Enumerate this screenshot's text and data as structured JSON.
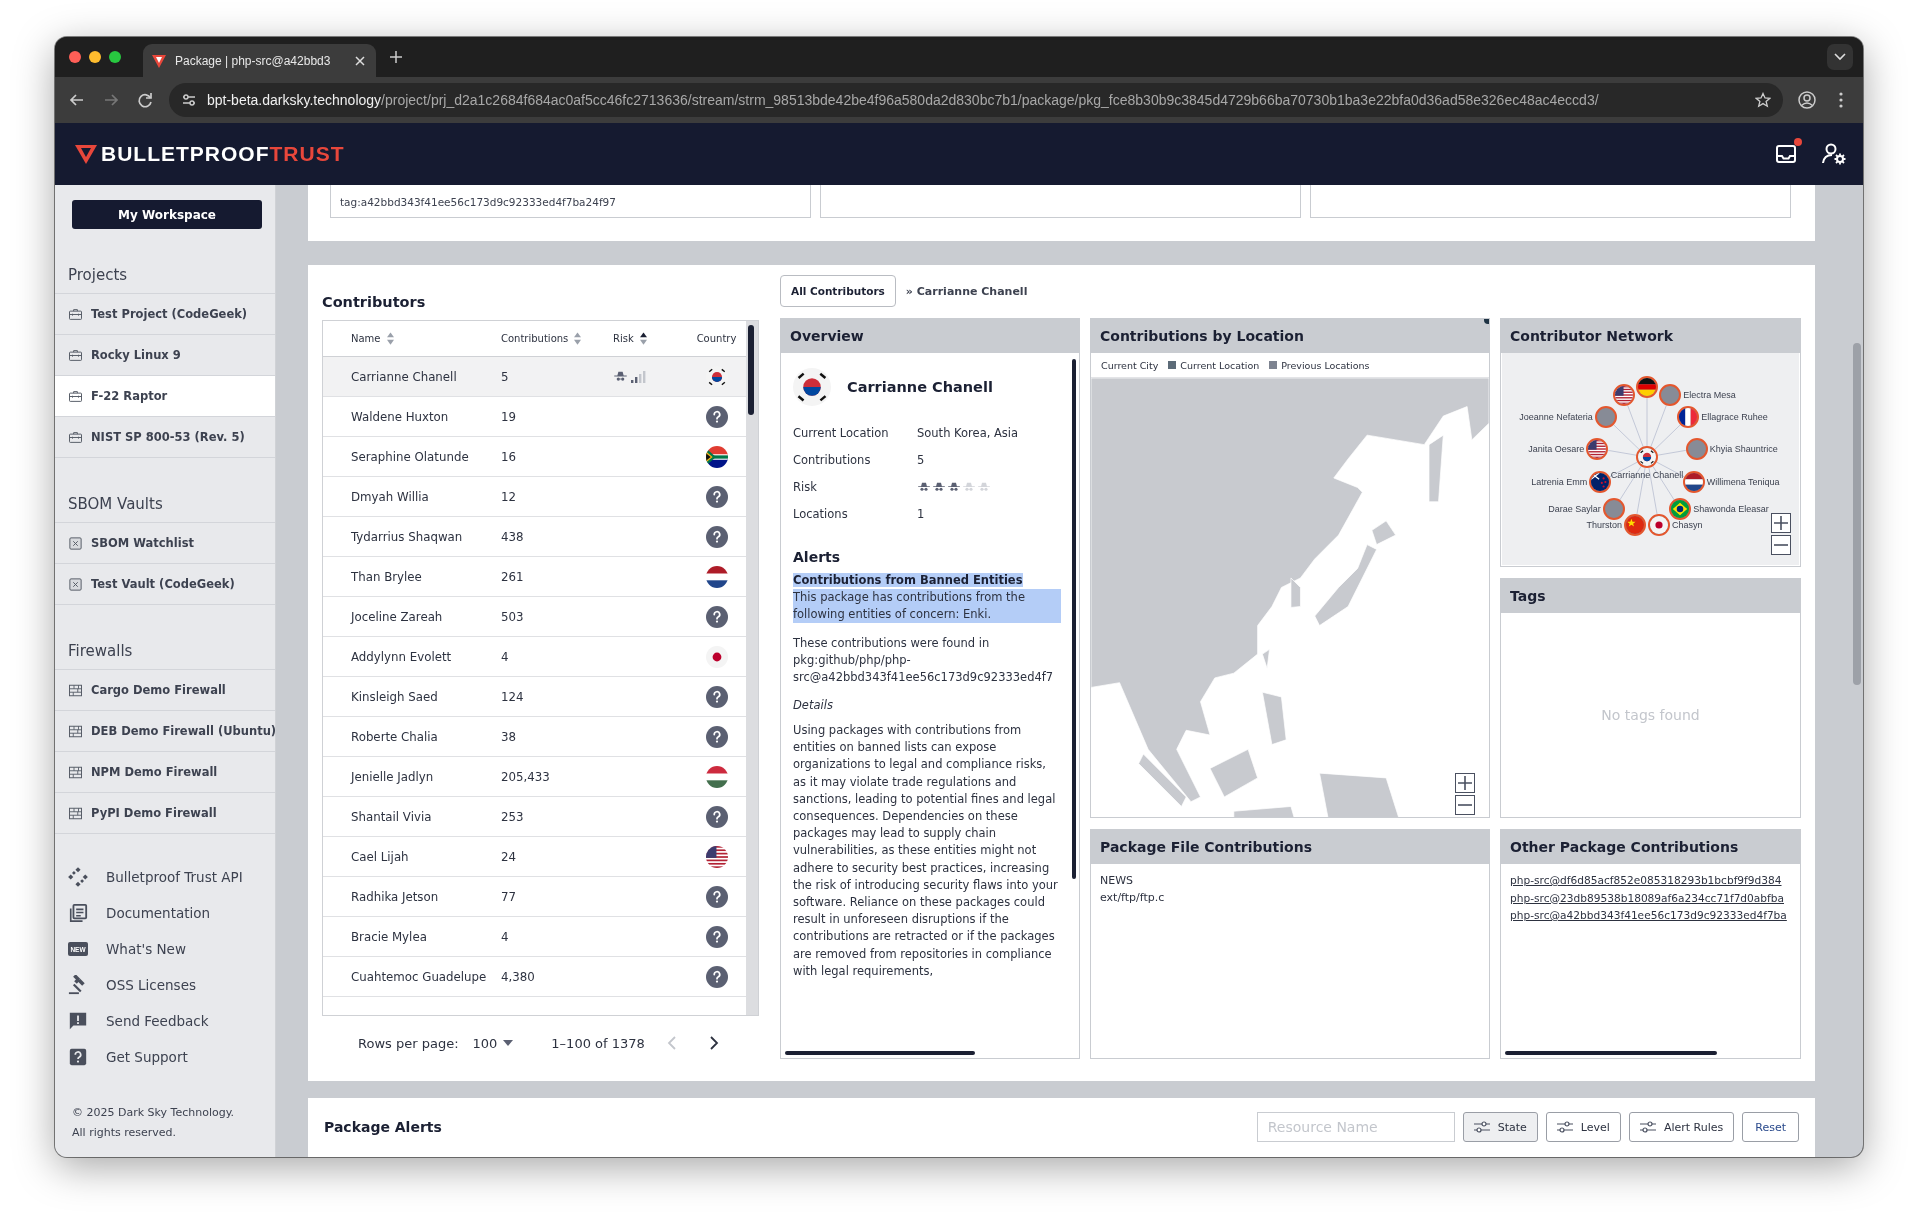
{
  "browser": {
    "tab_title": "Package | php-src@a42bbd3",
    "url_host": "bpt-beta.darksky.technology",
    "url_path": "/project/prj_d2a1c2684f684ac0af5cc46fc2713636/stream/strm_98513bde42be4f96a580da2d830bc7b1/package/pkg_fce8b30b9c3845d4729b66ba70730b1ba3e22bfa0d36ad58e326ec48ac4eccd3/"
  },
  "header": {
    "logo_primary": "BULLETPROOF",
    "logo_accent": "TRUST",
    "inbox_unread": true
  },
  "sidebar": {
    "workspace_button": "My Workspace",
    "sections": [
      {
        "title": "Projects",
        "items": [
          {
            "label": "Test Project (CodeGeek)",
            "kind": "project",
            "selected": false
          },
          {
            "label": "Rocky Linux 9",
            "kind": "project",
            "selected": false
          },
          {
            "label": "F-22 Raptor",
            "kind": "project",
            "selected": true
          },
          {
            "label": "NIST SP 800-53 (Rev. 5)",
            "kind": "project",
            "selected": false
          }
        ]
      },
      {
        "title": "SBOM Vaults",
        "items": [
          {
            "label": "SBOM Watchlist",
            "kind": "vault",
            "selected": false
          },
          {
            "label": "Test Vault (CodeGeek)",
            "kind": "vault",
            "selected": false
          }
        ]
      },
      {
        "title": "Firewalls",
        "items": [
          {
            "label": "Cargo Demo Firewall",
            "kind": "firewall",
            "selected": false
          },
          {
            "label": "DEB Demo Firewall (Ubuntu)",
            "kind": "firewall",
            "selected": false
          },
          {
            "label": "NPM Demo Firewall",
            "kind": "firewall",
            "selected": false
          },
          {
            "label": "PyPI Demo Firewall",
            "kind": "firewall",
            "selected": false
          }
        ]
      }
    ],
    "links": [
      {
        "label": "Bulletproof Trust API",
        "kind": "api"
      },
      {
        "label": "Documentation",
        "kind": "docs"
      },
      {
        "label": "What's New",
        "kind": "new",
        "badge": "NEW"
      },
      {
        "label": "OSS Licenses",
        "kind": "license"
      },
      {
        "label": "Send Feedback",
        "kind": "feedback"
      },
      {
        "label": "Get Support",
        "kind": "support"
      }
    ],
    "footer": [
      "© 2025 Dark Sky Technology.",
      "All rights reserved."
    ]
  },
  "top_cards": [
    {
      "kind": "tag",
      "text": "tag:a42bbd343f41ee56c173d9c92333ed4f7ba24f97"
    },
    {
      "kind": "empty"
    },
    {
      "kind": "empty"
    }
  ],
  "contributors": {
    "title": "Contributors",
    "columns": [
      {
        "label": "Name",
        "kind": "sortable"
      },
      {
        "label": "Contributions",
        "kind": "sortable"
      },
      {
        "label": "Risk",
        "kind": "ascending"
      },
      {
        "label": "Country",
        "kind": "plain"
      }
    ],
    "rows": [
      {
        "name": "Carrianne Chanell",
        "contributions": "5",
        "kind": "kr",
        "selected": true,
        "level": 0.5
      },
      {
        "name": "Waldene Huxton",
        "contributions": "19",
        "kind": "unknown",
        "selected": false
      },
      {
        "name": "Seraphine Olatunde",
        "contributions": "16",
        "kind": "za",
        "selected": false
      },
      {
        "name": "Dmyah Willia",
        "contributions": "12",
        "kind": "unknown",
        "selected": false
      },
      {
        "name": "Tydarrius Shaqwan",
        "contributions": "438",
        "kind": "unknown",
        "selected": false
      },
      {
        "name": "Than Brylee",
        "contributions": "261",
        "kind": "nl",
        "selected": false
      },
      {
        "name": "Joceline Zareah",
        "contributions": "503",
        "kind": "unknown",
        "selected": false
      },
      {
        "name": "Addylynn Evolett",
        "contributions": "4",
        "kind": "jp",
        "selected": false
      },
      {
        "name": "Kinsleigh Saed",
        "contributions": "124",
        "kind": "unknown",
        "selected": false
      },
      {
        "name": "Roberte Chalia",
        "contributions": "38",
        "kind": "unknown",
        "selected": false
      },
      {
        "name": "Jenielle Jadlyn",
        "contributions": "205,433",
        "kind": "hu",
        "selected": false
      },
      {
        "name": "Shantail Vivia",
        "contributions": "253",
        "kind": "unknown",
        "selected": false
      },
      {
        "name": "Cael Lijah",
        "contributions": "24",
        "kind": "us",
        "selected": false
      },
      {
        "name": "Radhika Jetson",
        "contributions": "77",
        "kind": "unknown",
        "selected": false
      },
      {
        "name": "Bracie Mylea",
        "contributions": "4",
        "kind": "unknown",
        "selected": false
      },
      {
        "name": "Cuahtemoc Guadelupe",
        "contributions": "4,380",
        "kind": "unknown",
        "selected": false
      }
    ],
    "pagination": {
      "rows_label": "Rows per page:",
      "rows_value": "100",
      "range": "1–100 of 1378",
      "prev": {
        "disabled": true
      },
      "next": {
        "disabled": false
      }
    }
  },
  "breadcrumb": {
    "button": "All Contributors",
    "current": "» Carrianne Chanell"
  },
  "overview": {
    "title": "Overview",
    "name": "Carrianne Chanell",
    "kind": "kr",
    "fields": [
      {
        "label": "Current Location",
        "kind": "text",
        "value": "South Korea, Asia"
      },
      {
        "label": "Contributions",
        "kind": "text",
        "value": "5"
      },
      {
        "label": "Risk",
        "kind": "stars",
        "stars": 3
      },
      {
        "label": "Locations",
        "kind": "text",
        "value": "1"
      }
    ],
    "alerts_title": "Alerts",
    "alerts": [
      {
        "title": "Contributions from Banned Entities",
        "message": "This package has contributions from the following entities of concern: Enki.",
        "highlighted": true,
        "found_in": "These contributions were found in pkg:github/php/php-src@a42bbd343f41ee56c173d9c92333ed4f7",
        "details_label": "Details",
        "details": "Using packages with contributions from entities on banned lists can expose organizations to legal and compliance risks, as it may violate trade regulations and sanctions, leading to potential fines and legal consequences. Dependencies on these packages may lead to supply chain vulnerabilities, as these entities might not adhere to security best practices, increasing the risk of introducing security flaws into your software. Reliance on these packages could result in unforeseen disruptions if the contributions are retracted or if the packages are removed from repositories in compliance with legal requirements,"
      }
    ]
  },
  "location": {
    "title": "Contributions by Location",
    "legend": [
      {
        "label": "Current City",
        "kind": "dot",
        "color": "#1e3344"
      },
      {
        "label": "Current Location",
        "kind": "square",
        "color": "#5c6b78"
      },
      {
        "label": "Previous Locations",
        "kind": "square",
        "color": "#7d8390"
      }
    ]
  },
  "network": {
    "title": "Contributor Network",
    "center": {
      "label": "Carrianne Chanell",
      "kind": "kr"
    },
    "nodes": [
      {
        "kind": "de"
      },
      {
        "kind": "us"
      },
      {
        "label": "Electra Mesa",
        "kind": "unknown"
      },
      {
        "label": "Joeanne Nefateria",
        "kind": "unknown"
      },
      {
        "label": "Ellagrace Ruhee",
        "kind": "fr"
      },
      {
        "label": "Janita Oesare",
        "kind": "us"
      },
      {
        "label": "Khyia Shauntrice",
        "kind": "unknown"
      },
      {
        "label": "Latrenia Emm",
        "kind": "nz"
      },
      {
        "label": "Willimena Teniqua",
        "kind": "nl"
      },
      {
        "label": "Darae Saylar",
        "kind": "unknown"
      },
      {
        "label": "Shawonda Eleasar",
        "kind": "br"
      },
      {
        "label": "Thurston",
        "kind": "cn"
      },
      {
        "label": "Chasyn",
        "kind": "jp"
      }
    ]
  },
  "tags": {
    "title": "Tags",
    "empty_text": "No tags found"
  },
  "files": {
    "title": "Package File Contributions",
    "items": [
      "NEWS",
      "ext/ftp/ftp.c"
    ]
  },
  "other_packages": {
    "title": "Other Package Contributions",
    "links": [
      "php-src@df6d85acf852e085318293b1bcbf9f9d384",
      "php-src@23db89538b18089af6a234cc71f7d0abfba",
      "php-src@a42bbd343f41ee56c173d9c92333ed4f7ba"
    ]
  },
  "alerts_bar": {
    "title": "Package Alerts",
    "search_placeholder": "Resource Name",
    "filters": [
      {
        "label": "State",
        "selected": true
      },
      {
        "label": "Level",
        "selected": false
      },
      {
        "label": "Alert Rules",
        "selected": false
      }
    ],
    "reset": "Reset"
  }
}
